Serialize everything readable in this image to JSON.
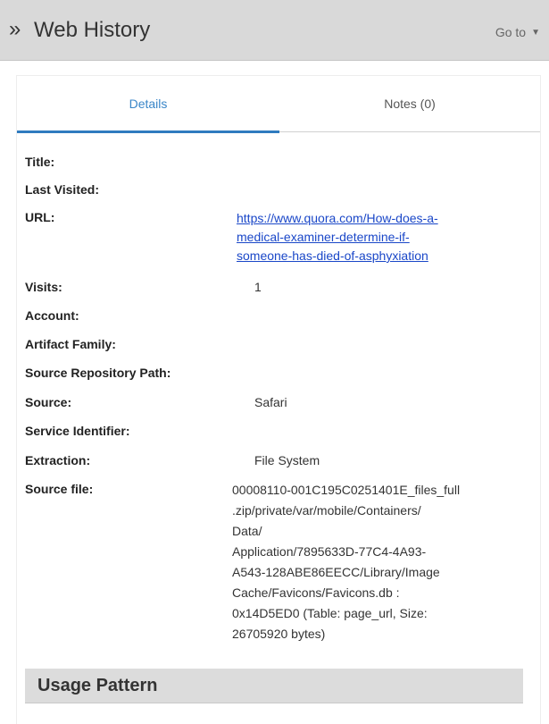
{
  "header": {
    "expand_glyph": "»",
    "title": "Web History",
    "goto_label": "Go to"
  },
  "tabs": [
    {
      "label": "Details",
      "active": true
    },
    {
      "label": "Notes (0)",
      "active": false
    }
  ],
  "fields": {
    "title": {
      "label": "Title:",
      "value": ""
    },
    "last_visited": {
      "label": "Last Visited:",
      "value": ""
    },
    "url": {
      "label": "URL:",
      "lines": [
        "https://www.quora.com/How-does-a-",
        "medical-examiner-determine-if-",
        "someone-has-died-of-asphyxiation"
      ]
    },
    "visits": {
      "label": "Visits:",
      "value": "1"
    },
    "account": {
      "label": "Account:",
      "value": ""
    },
    "artifact_family": {
      "label": "Artifact Family:",
      "value": ""
    },
    "source_repository_path": {
      "label": "Source Repository Path:",
      "value": ""
    },
    "source": {
      "label": "Source:",
      "value": "Safari"
    },
    "service_identifier": {
      "label": "Service Identifier:",
      "value": ""
    },
    "extraction": {
      "label": "Extraction:",
      "value": "File System"
    },
    "source_file": {
      "label": "Source file:",
      "lines": [
        "00008110-001C195C0251401E_files_full",
        ".zip/private/var/mobile/Containers/",
        "Data/",
        "Application/7895633D-77C4-4A93-",
        "A543-128ABE86EECC/Library/Image",
        "Cache/Favicons/Favicons.db :",
        "0x14D5ED0 (Table: page_url, Size:",
        "26705920 bytes)"
      ]
    }
  },
  "usage_section": {
    "title": "Usage Pattern"
  },
  "colors": {
    "header_bg": "#d9d9d9",
    "active_tab": "#3a86c8",
    "link": "#1a47c8"
  }
}
